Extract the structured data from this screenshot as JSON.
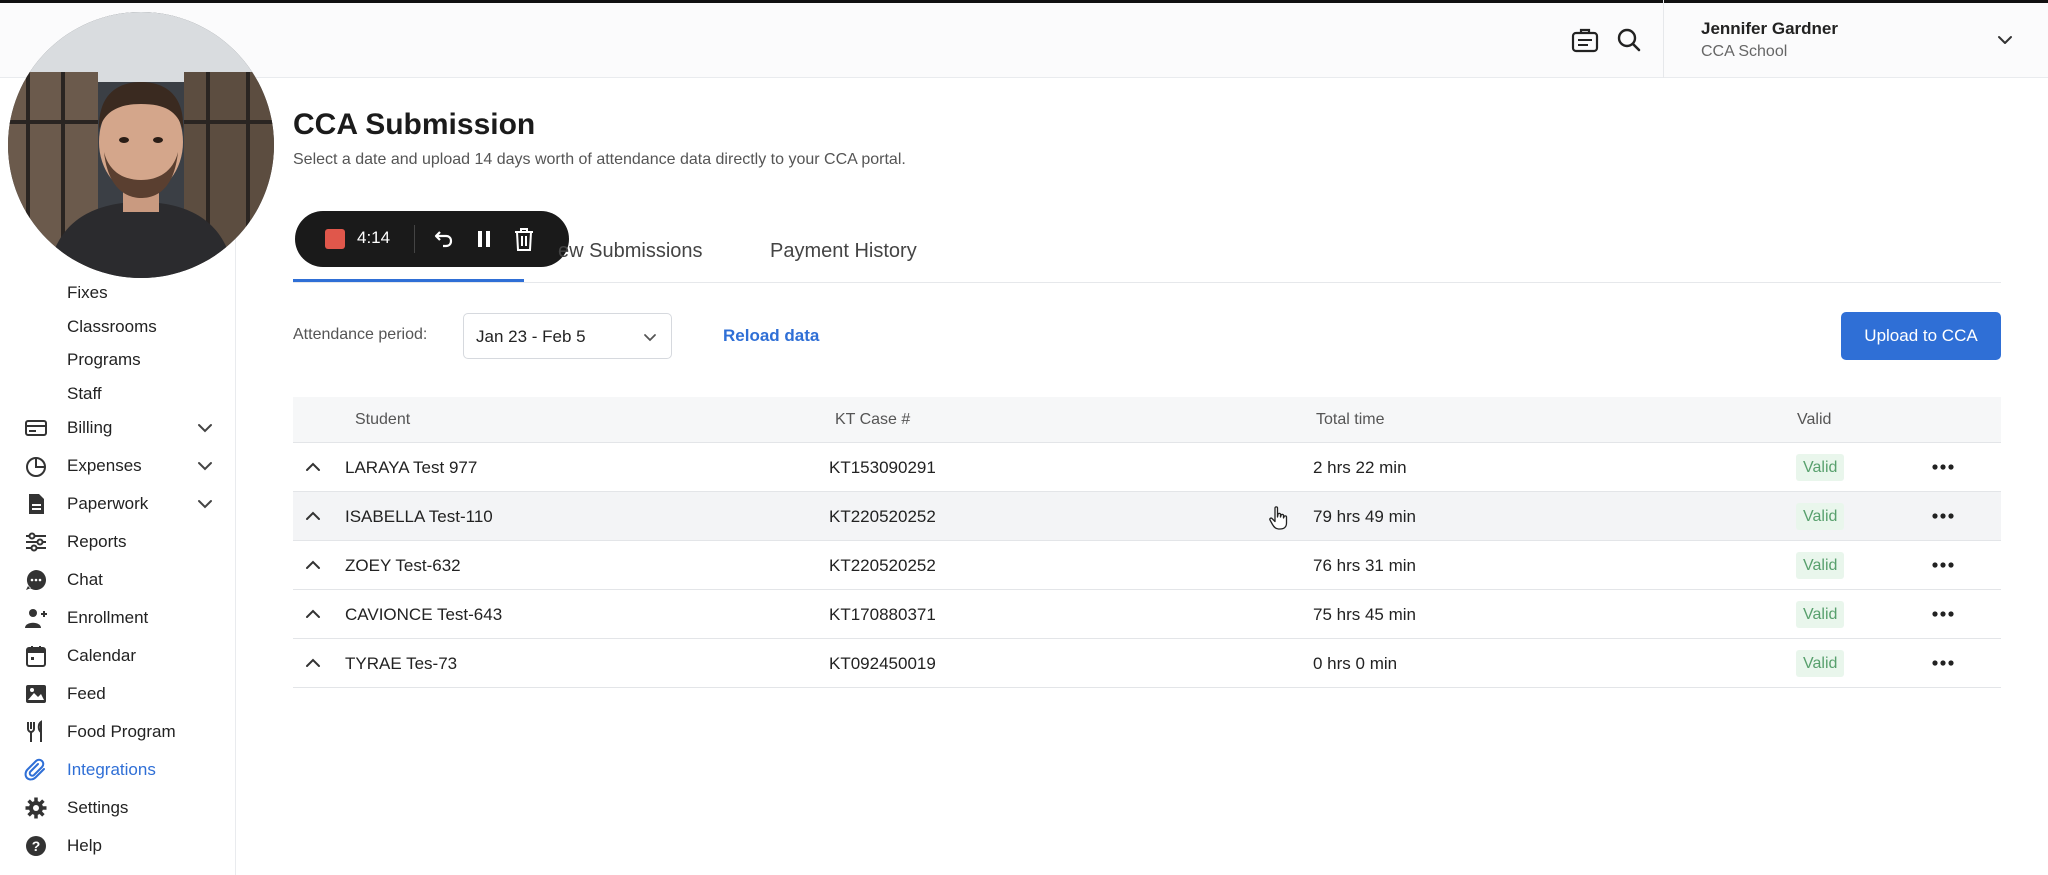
{
  "header": {
    "user_name": "Jennifer Gardner",
    "school": "CCA School"
  },
  "recorder": {
    "time": "4:14"
  },
  "sidebar": {
    "sub_items": [
      "Fixes",
      "Classrooms",
      "Programs",
      "Staff"
    ],
    "items": [
      {
        "label": "Billing",
        "icon": "billing-icon",
        "expandable": true
      },
      {
        "label": "Expenses",
        "icon": "pie-chart-icon",
        "expandable": true
      },
      {
        "label": "Paperwork",
        "icon": "document-icon",
        "expandable": true
      },
      {
        "label": "Reports",
        "icon": "sliders-icon",
        "expandable": false
      },
      {
        "label": "Chat",
        "icon": "chat-icon",
        "expandable": false
      },
      {
        "label": "Enrollment",
        "icon": "add-person-icon",
        "expandable": false
      },
      {
        "label": "Calendar",
        "icon": "calendar-icon",
        "expandable": false
      },
      {
        "label": "Feed",
        "icon": "image-icon",
        "expandable": false
      },
      {
        "label": "Food Program",
        "icon": "utensils-icon",
        "expandable": false
      },
      {
        "label": "Integrations",
        "icon": "paperclip-icon",
        "expandable": false,
        "active": true
      },
      {
        "label": "Settings",
        "icon": "gear-icon",
        "expandable": false
      },
      {
        "label": "Help",
        "icon": "help-icon",
        "expandable": false
      }
    ],
    "active_color": "#2f6fd6"
  },
  "page": {
    "title": "CCA Submission",
    "description": "Select a date and upload 14 days worth of attendance data directly to your CCA portal.",
    "tabs": [
      "ew Submissions",
      "Payment History"
    ],
    "attendance_label": "Attendance period:",
    "attendance_value": "Jan 23 - Feb 5",
    "reload_label": "Reload data",
    "upload_label": "Upload to CCA"
  },
  "table": {
    "headers": [
      "Student",
      "KT Case #",
      "Total time",
      "Valid"
    ],
    "rows": [
      {
        "student": "LARAYA Test 977",
        "case": "KT153090291",
        "time": "2 hrs 22 min",
        "valid": "Valid"
      },
      {
        "student": "ISABELLA Test-110",
        "case": "KT220520252",
        "time": "79 hrs 49 min",
        "valid": "Valid"
      },
      {
        "student": "ZOEY Test-632",
        "case": "KT220520252",
        "time": "76 hrs 31 min",
        "valid": "Valid"
      },
      {
        "student": "CAVIONCE Test-643",
        "case": "KT170880371",
        "time": "75 hrs 45 min",
        "valid": "Valid"
      },
      {
        "student": "TYRAE Tes-73",
        "case": "KT092450019",
        "time": "0 hrs 0 min",
        "valid": "Valid"
      }
    ]
  },
  "colors": {
    "accent": "#2f6fd6",
    "valid_bg": "#e9f6ec",
    "valid_text": "#58a06d",
    "record": "#e0574b"
  }
}
